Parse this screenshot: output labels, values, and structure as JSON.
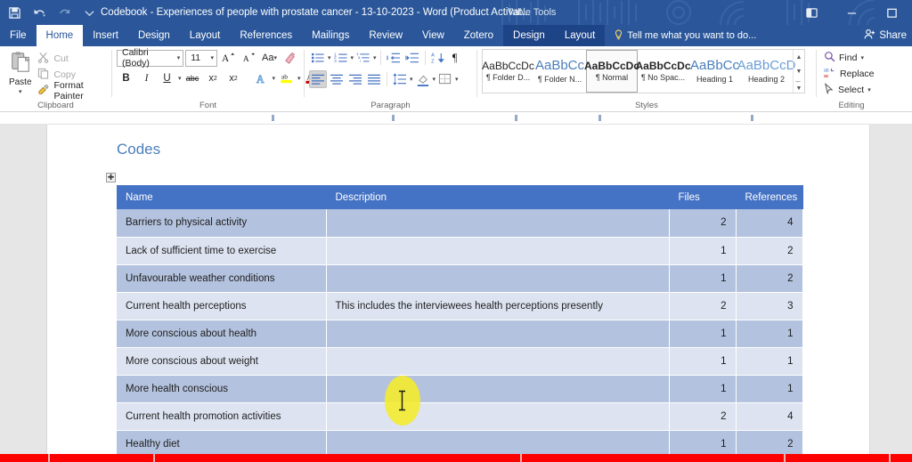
{
  "titlebar": {
    "document_title": "Codebook - Experiences of people with prostate cancer - 13-10-2023 - Word (Product Activat...",
    "contextual_tools_label": "Table Tools",
    "quick_access": [
      {
        "name": "save-icon",
        "label": "Save"
      },
      {
        "name": "undo-icon",
        "label": "Undo"
      },
      {
        "name": "redo-icon",
        "label": "Redo"
      },
      {
        "name": "customize-qat-icon",
        "label": "Customize Quick Access Toolbar"
      }
    ],
    "window_controls": [
      {
        "name": "ribbon-display-options-icon",
        "label": "Ribbon Display Options"
      },
      {
        "name": "minimize-icon",
        "label": "Minimize"
      },
      {
        "name": "maximize-icon",
        "label": "Maximize"
      }
    ]
  },
  "tabs": {
    "main": [
      {
        "label": "File",
        "active": false
      },
      {
        "label": "Home",
        "active": true
      },
      {
        "label": "Insert",
        "active": false
      },
      {
        "label": "Design",
        "active": false
      },
      {
        "label": "Layout",
        "active": false
      },
      {
        "label": "References",
        "active": false
      },
      {
        "label": "Mailings",
        "active": false
      },
      {
        "label": "Review",
        "active": false
      },
      {
        "label": "View",
        "active": false
      },
      {
        "label": "Zotero",
        "active": false
      }
    ],
    "table_tools": [
      {
        "label": "Design"
      },
      {
        "label": "Layout"
      }
    ],
    "tell_me": "Tell me what you want to do...",
    "share": "Share"
  },
  "ribbon": {
    "clipboard": {
      "group_label": "Clipboard",
      "paste": "Paste",
      "cut": "Cut",
      "copy": "Copy",
      "format_painter": "Format Painter"
    },
    "font": {
      "group_label": "Font",
      "font_name": "Calibri (Body)",
      "font_size": "11",
      "grow_font": "A",
      "shrink_font": "A",
      "change_case": "Aa",
      "clear_formatting": "Clear All Formatting",
      "bold": "B",
      "italic": "I",
      "underline": "U",
      "strikethrough": "abc",
      "subscript": "x",
      "superscript": "x",
      "text_effects": "A",
      "highlight": "ab",
      "font_color": "A"
    },
    "paragraph": {
      "group_label": "Paragraph",
      "buttons": [
        "bullets",
        "numbering",
        "multilevel-list",
        "decrease-indent",
        "increase-indent",
        "sort",
        "show-formatting-marks",
        "align-left",
        "center",
        "align-right",
        "justify",
        "line-spacing",
        "shading",
        "borders"
      ]
    },
    "styles": {
      "group_label": "Styles",
      "items": [
        {
          "preview": "AaBbCcDc",
          "name": "¶ Folder D...",
          "selected": false,
          "color": "#262626",
          "size": "12px"
        },
        {
          "preview": "AaBbCc",
          "name": "¶ Folder N...",
          "selected": false,
          "color": "#4a7ebb",
          "size": "15px"
        },
        {
          "preview": "AaBbCcDc",
          "name": "¶ Normal",
          "selected": true,
          "color": "#262626",
          "size": "12px"
        },
        {
          "preview": "AaBbCcDc",
          "name": "¶ No Spac...",
          "selected": false,
          "color": "#262626",
          "size": "12px"
        },
        {
          "preview": "AaBbCc",
          "name": "Heading 1",
          "selected": false,
          "color": "#4a7ebb",
          "size": "15px"
        },
        {
          "preview": "AaBbCcD",
          "name": "Heading 2",
          "selected": false,
          "color": "#6a9ed4",
          "size": "15px"
        }
      ]
    },
    "editing": {
      "group_label": "Editing",
      "find": "Find",
      "replace": "Replace",
      "select": "Select"
    }
  },
  "document": {
    "heading": "Codes",
    "table": {
      "columns": [
        "Name",
        "Description",
        "Files",
        "References"
      ],
      "rows": [
        {
          "name": "Barriers to physical activity",
          "description": "",
          "files": "2",
          "references": "4",
          "indent": false,
          "band": "a"
        },
        {
          "name": "Lack of sufficient time to exercise",
          "description": "",
          "files": "1",
          "references": "2",
          "indent": true,
          "band": "b"
        },
        {
          "name": "Unfavourable weather conditions",
          "description": "",
          "files": "1",
          "references": "2",
          "indent": true,
          "band": "a"
        },
        {
          "name": "Current health perceptions",
          "description": "This includes the interviewees health perceptions presently",
          "files": "2",
          "references": "3",
          "indent": false,
          "band": "b"
        },
        {
          "name": "More conscious about health",
          "description": "",
          "files": "1",
          "references": "1",
          "indent": true,
          "band": "a"
        },
        {
          "name": "More conscious about weight",
          "description": "",
          "files": "1",
          "references": "1",
          "indent": true,
          "band": "b"
        },
        {
          "name": "More health conscious",
          "description": "",
          "files": "1",
          "references": "1",
          "indent": true,
          "band": "a"
        },
        {
          "name": "Current health promotion activities",
          "description": "",
          "files": "2",
          "references": "4",
          "indent": false,
          "band": "b"
        },
        {
          "name": "Healthy diet",
          "description": "",
          "files": "1",
          "references": "2",
          "indent": true,
          "band": "a"
        }
      ]
    }
  },
  "colors": {
    "titlebar": "#2b579a",
    "accent": "#4472c4",
    "heading": "#4a7ebb",
    "band_dark": "#b3c2de",
    "band_light": "#dde3f0",
    "cursor_highlight": "#f5ec2a",
    "progress_bar": "#ff0000"
  }
}
